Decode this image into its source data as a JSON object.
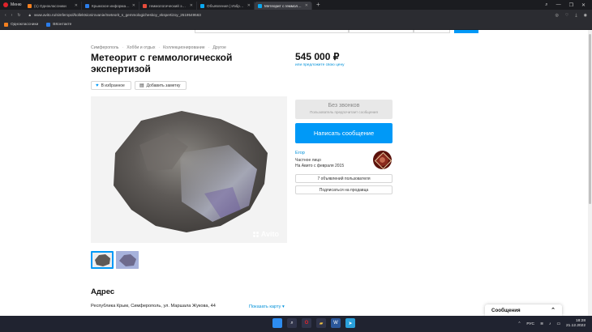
{
  "browser": {
    "menu_label": "Меню",
    "tabs": [
      {
        "title": "(1) Одноклассники",
        "favicon_color": "#f4801f",
        "active": false
      },
      {
        "title": "Крымское информацион",
        "favicon_color": "#2b7de9",
        "active": false
      },
      {
        "title": "геммологический экспе",
        "favicon_color": "#e74c3c",
        "active": false
      },
      {
        "title": "Объявления | Избранное",
        "favicon_color": "#0aa8f0",
        "active": false
      },
      {
        "title": "Метеорит с геммологи",
        "favicon_color": "#0aa8f0",
        "active": true
      }
    ],
    "address": "www.avito.ru/simferopol/kollektsionirovanie/meteorit_s_gemmologicheskoy_ekspertizoy_2519549563",
    "bookmarks": [
      {
        "label": "Одноклассники",
        "color": "#f4801f"
      },
      {
        "label": "ВКонтакте",
        "color": "#2b7de9"
      }
    ]
  },
  "page": {
    "breadcrumb": [
      "Симферополь",
      "Хобби и отдых",
      "Коллекционирование",
      "Другое"
    ],
    "title": "Метеорит с геммологической экспертизой",
    "favorite_label": "В избранное",
    "note_label": "Добавить заметку",
    "watermark": "Avito",
    "price": "545 000 ₽",
    "price_sub": "или предложите свою цену",
    "no_calls_title": "Без звонков",
    "no_calls_sub": "Пользователь предпочитает сообщения",
    "write_button": "Написать сообщение",
    "seller": {
      "name": "Егор",
      "type": "Частное лицо",
      "since": "На Авито с февраля 2015"
    },
    "user_ads_button": "7 объявлений пользователя",
    "subscribe_button": "Подписаться на продавца",
    "address_heading": "Адрес",
    "address_text": "Республика Крым, Симферополь, ул. Маршала Жукова, 44",
    "show_map": "Показать карту",
    "messages_panel": "Сообщения"
  },
  "taskbar": {
    "lang": "РУС",
    "time": "18:28",
    "date": "21.12.2022"
  },
  "colors": {
    "accent": "#0099f7",
    "link": "#0091d9"
  }
}
